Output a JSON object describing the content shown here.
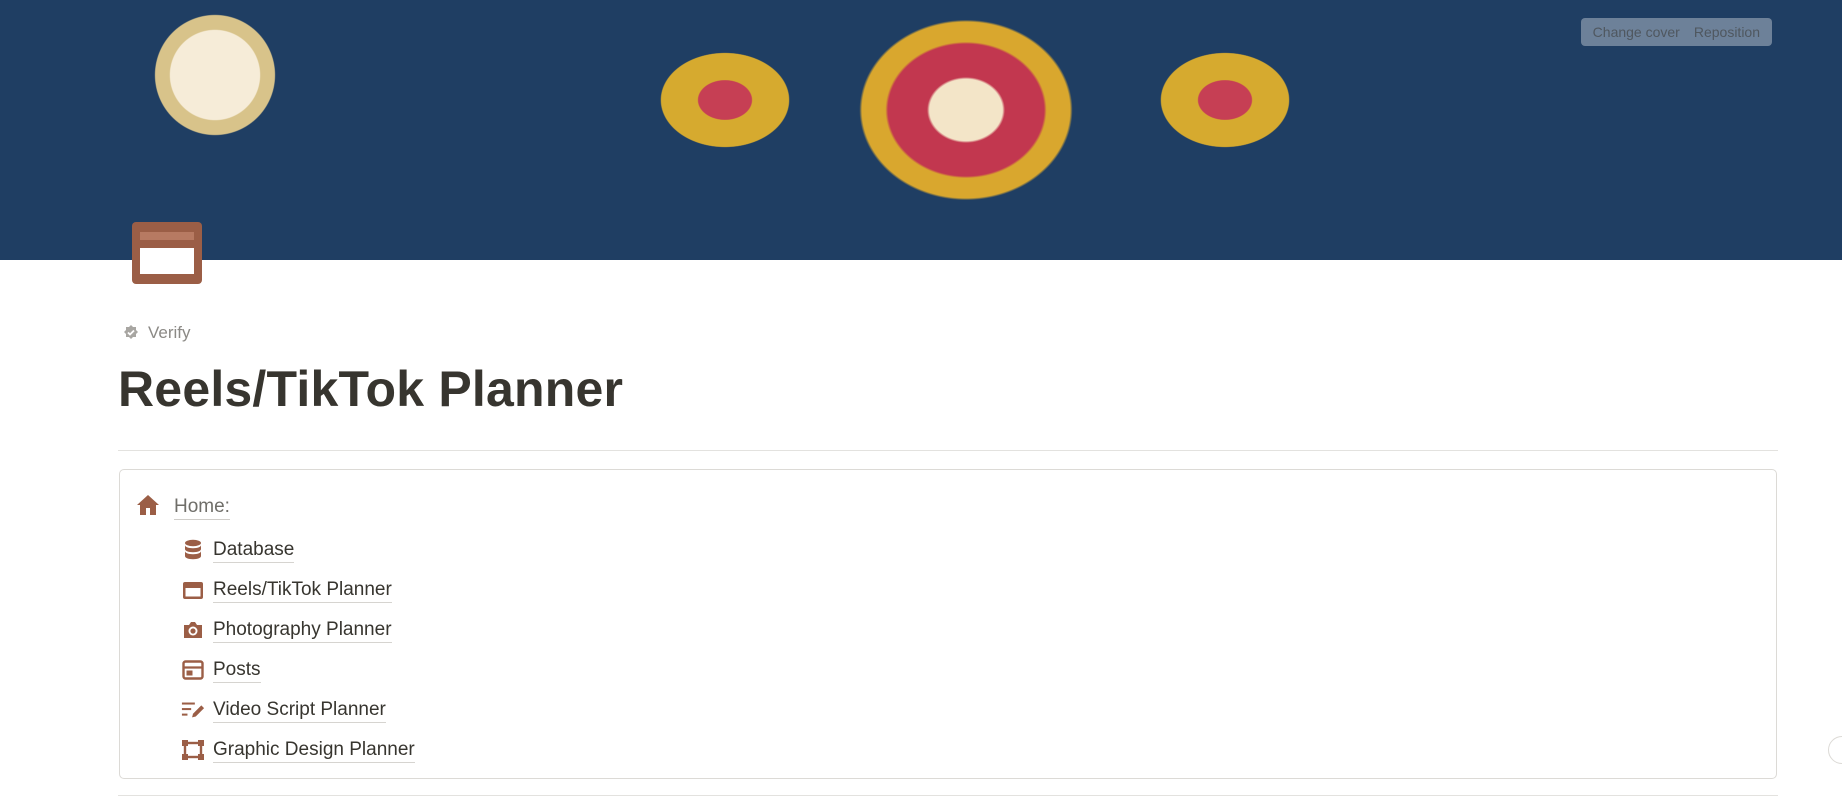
{
  "cover": {
    "change_cover_label": "Change cover",
    "reposition_label": "Reposition"
  },
  "page": {
    "verify_label": "Verify",
    "title": "Reels/TikTok Planner",
    "icon": "calendar-icon",
    "accent_color": "#9b5e46"
  },
  "nav": {
    "home_label": "Home:",
    "home_icon": "home-icon",
    "items": [
      {
        "label": "Database",
        "icon": "database-icon"
      },
      {
        "label": "Reels/TikTok Planner",
        "icon": "calendar-icon"
      },
      {
        "label": "Photography Planner",
        "icon": "camera-icon"
      },
      {
        "label": "Posts",
        "icon": "layout-icon"
      },
      {
        "label": "Video Script Planner",
        "icon": "script-edit-icon"
      },
      {
        "label": "Graphic Design Planner",
        "icon": "design-frame-icon"
      }
    ]
  }
}
